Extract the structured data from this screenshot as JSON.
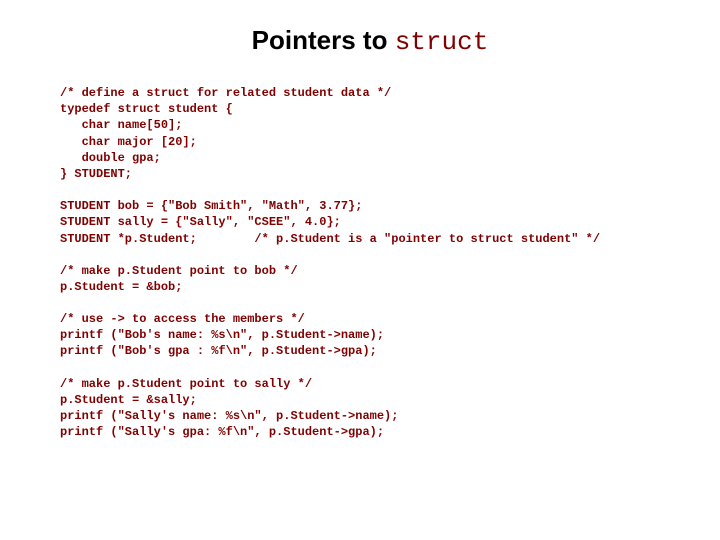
{
  "title": {
    "prefix": "Pointers to ",
    "mono": "struct"
  },
  "code": {
    "b1": "/* define a struct for related student data */\ntypedef struct student {\n   char name[50];\n   char major [20];\n   double gpa;\n} STUDENT;",
    "b2": "STUDENT bob = {\"Bob Smith\", \"Math\", 3.77};\nSTUDENT sally = {\"Sally\", \"CSEE\", 4.0};\nSTUDENT *p.Student;        /* p.Student is a \"pointer to struct student\" */",
    "b3": "/* make p.Student point to bob */\np.Student = &bob;",
    "b4": "/* use -> to access the members */\nprintf (\"Bob's name: %s\\n\", p.Student->name);\nprintf (\"Bob's gpa : %f\\n\", p.Student->gpa);",
    "b5": "/* make p.Student point to sally */\np.Student = &sally;\nprintf (\"Sally's name: %s\\n\", p.Student->name);\nprintf (\"Sally's gpa: %f\\n\", p.Student->gpa);"
  }
}
